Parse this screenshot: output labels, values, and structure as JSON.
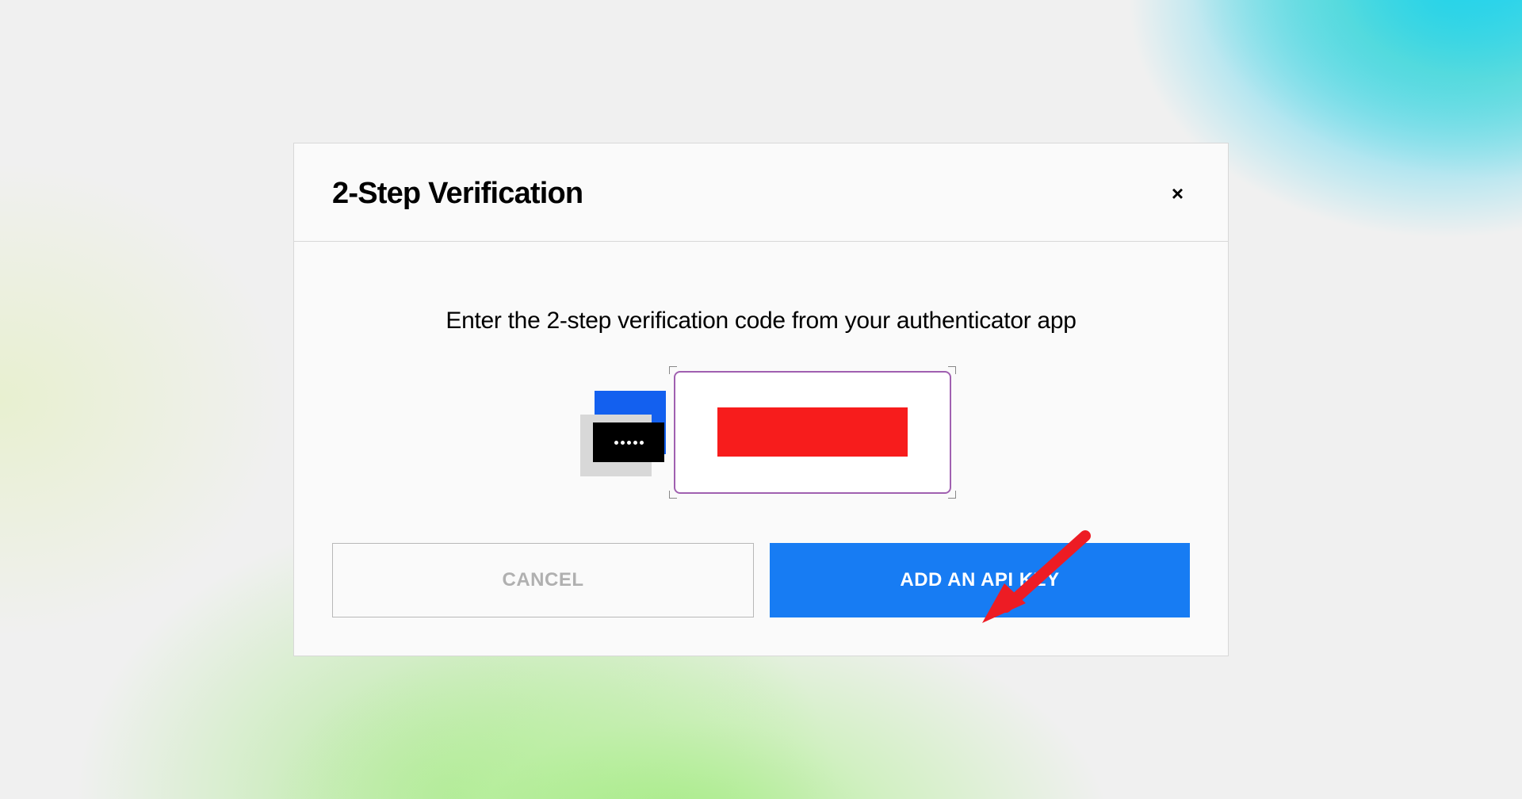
{
  "modal": {
    "title": "2-Step Verification",
    "instruction": "Enter the 2-step verification code from your authenticator app",
    "close_label": "×"
  },
  "buttons": {
    "cancel": "CANCEL",
    "primary": "ADD AN API KEY"
  },
  "colors": {
    "primary_blue": "#177cf3",
    "redaction_red": "#f71c1c",
    "arrow_red": "#ed1c24",
    "highlight_purple": "#a060b0"
  },
  "annotation": {
    "arrow_target": "add-api-key-button",
    "input_redacted": true
  }
}
